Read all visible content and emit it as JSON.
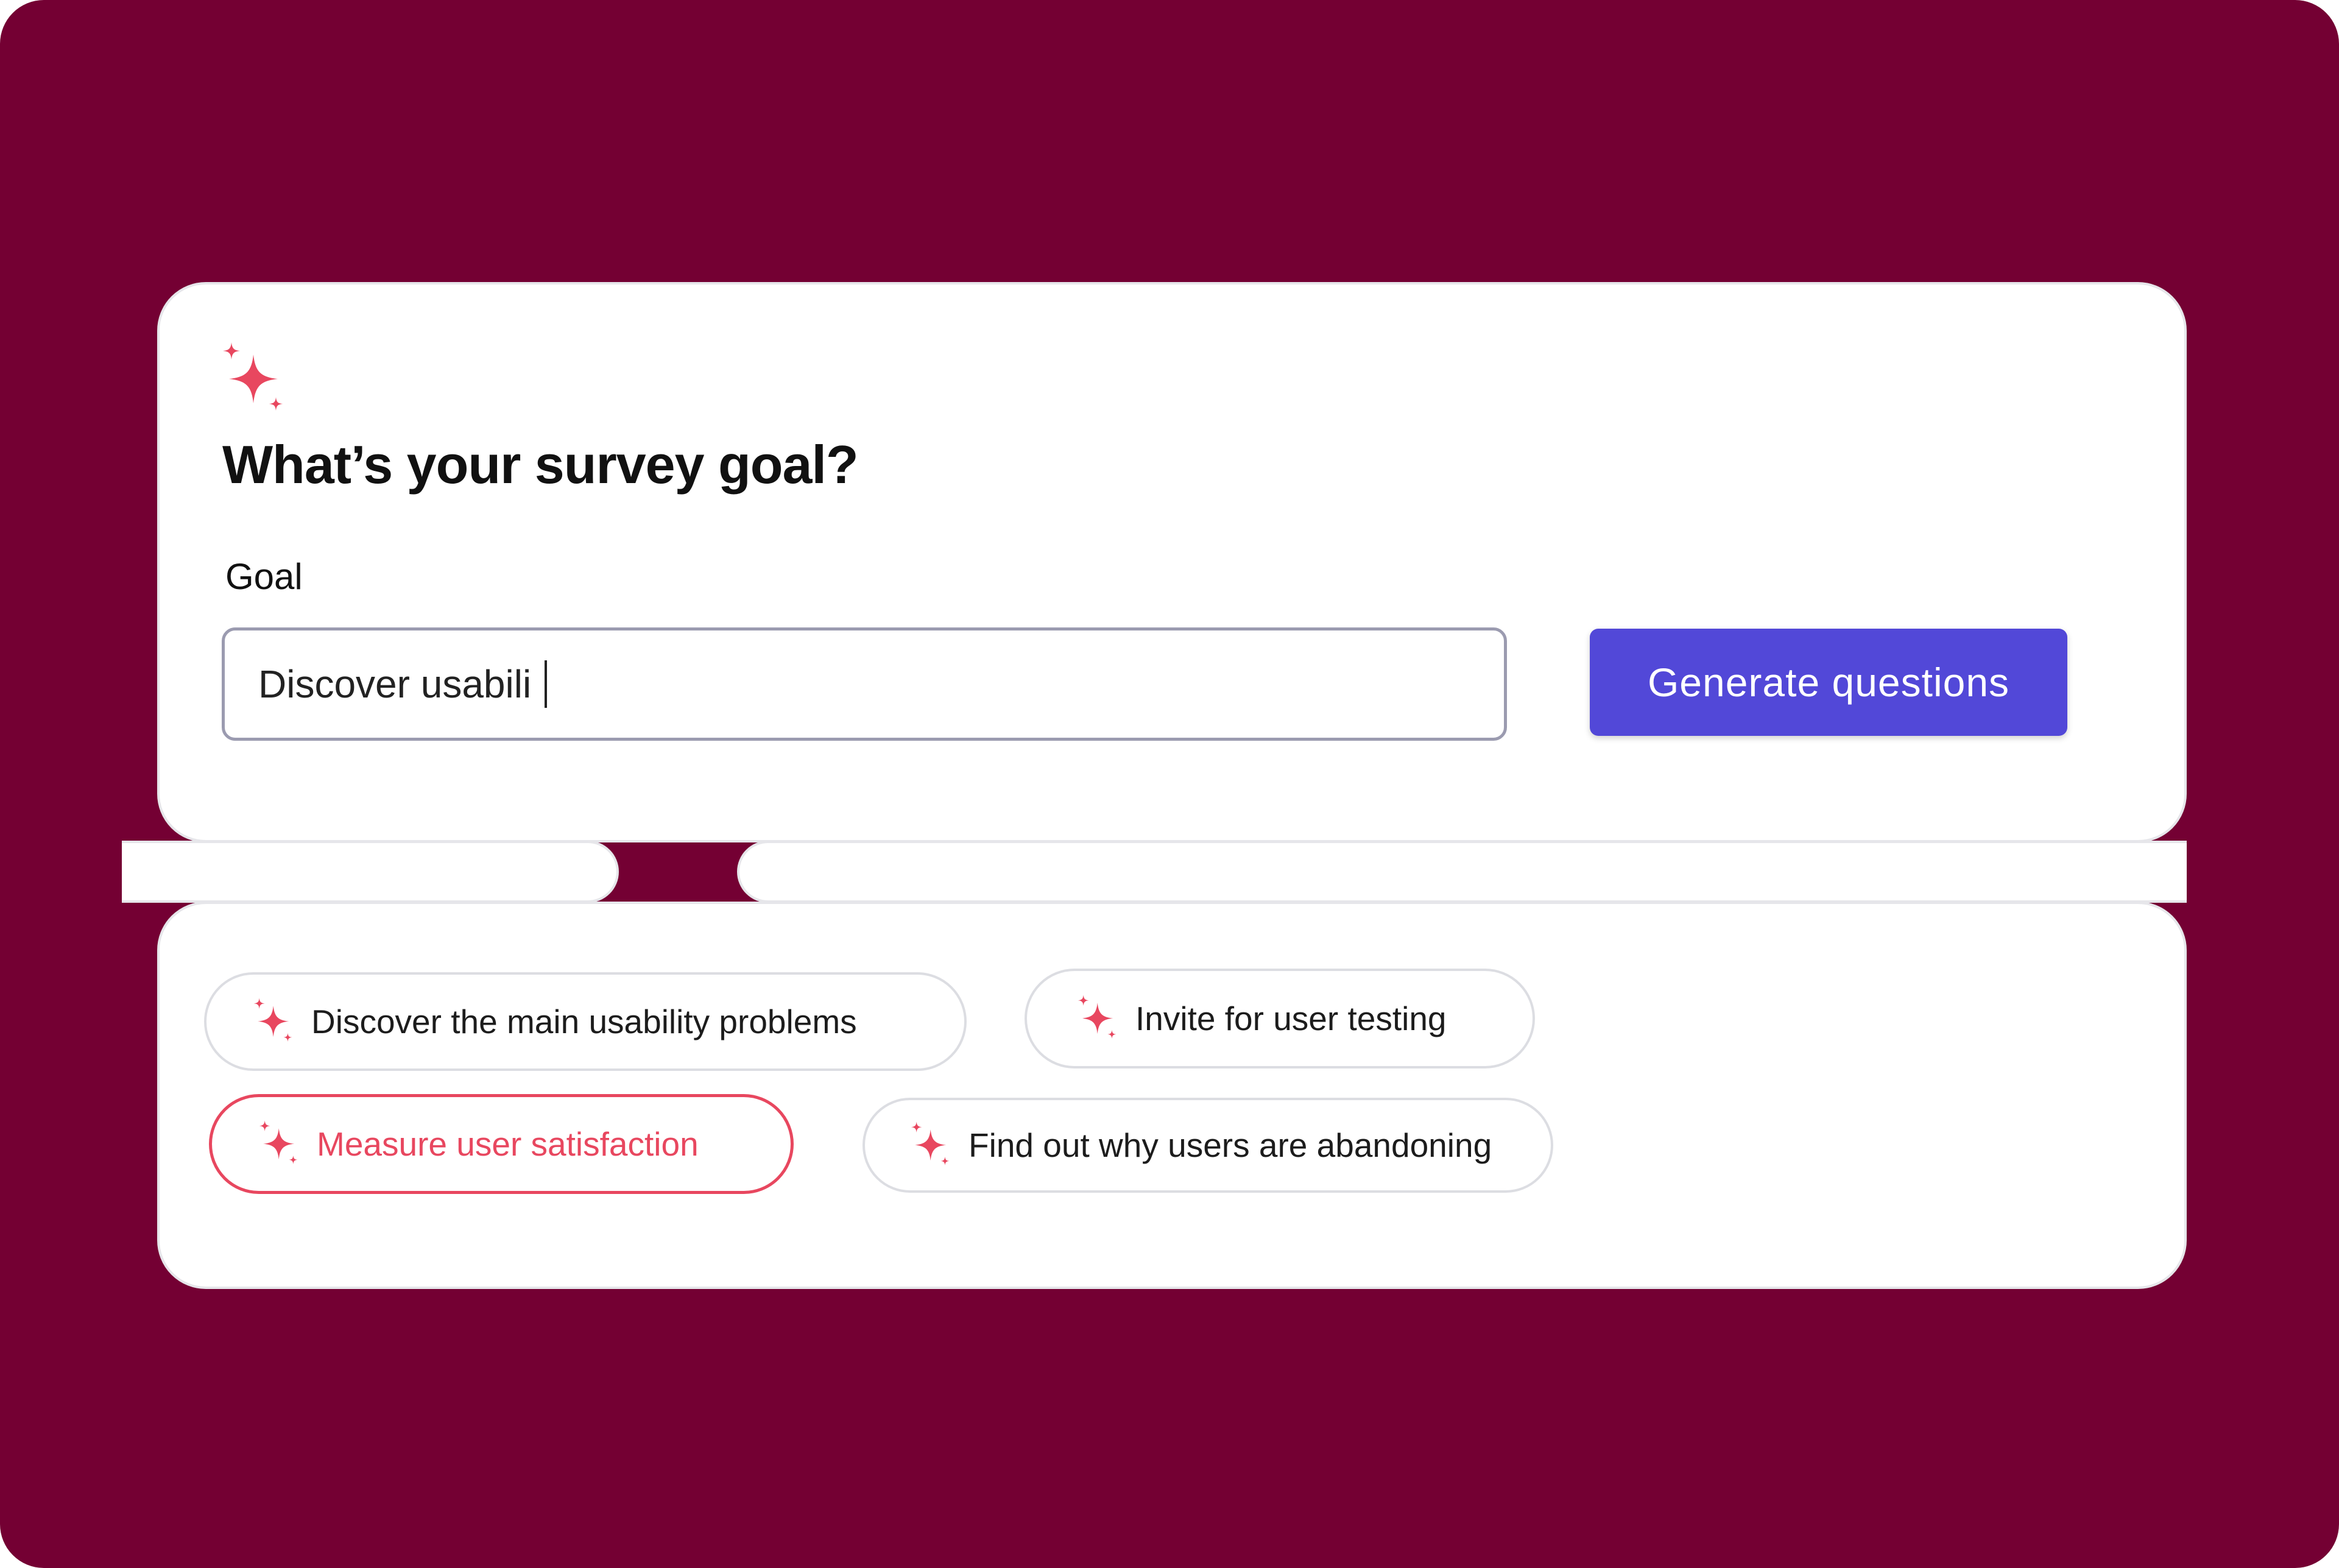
{
  "title": "What’s your survey goal?",
  "goal": {
    "label": "Goal",
    "value": "Discover usabili"
  },
  "generate_button": "Generate questions",
  "suggestions": [
    {
      "label": "Discover the main usability problems",
      "selected": false
    },
    {
      "label": "Invite for user testing",
      "selected": false
    },
    {
      "label": "Measure user satisfaction",
      "selected": true
    },
    {
      "label": "Find out why users are abandoning",
      "selected": false
    }
  ],
  "icons": {
    "header": "sparkle-icon",
    "chip": "sparkle-icon"
  },
  "colors": {
    "background": "#740033",
    "accent": "#e8475f",
    "button": "#5248d8",
    "card": "#ffffff"
  }
}
